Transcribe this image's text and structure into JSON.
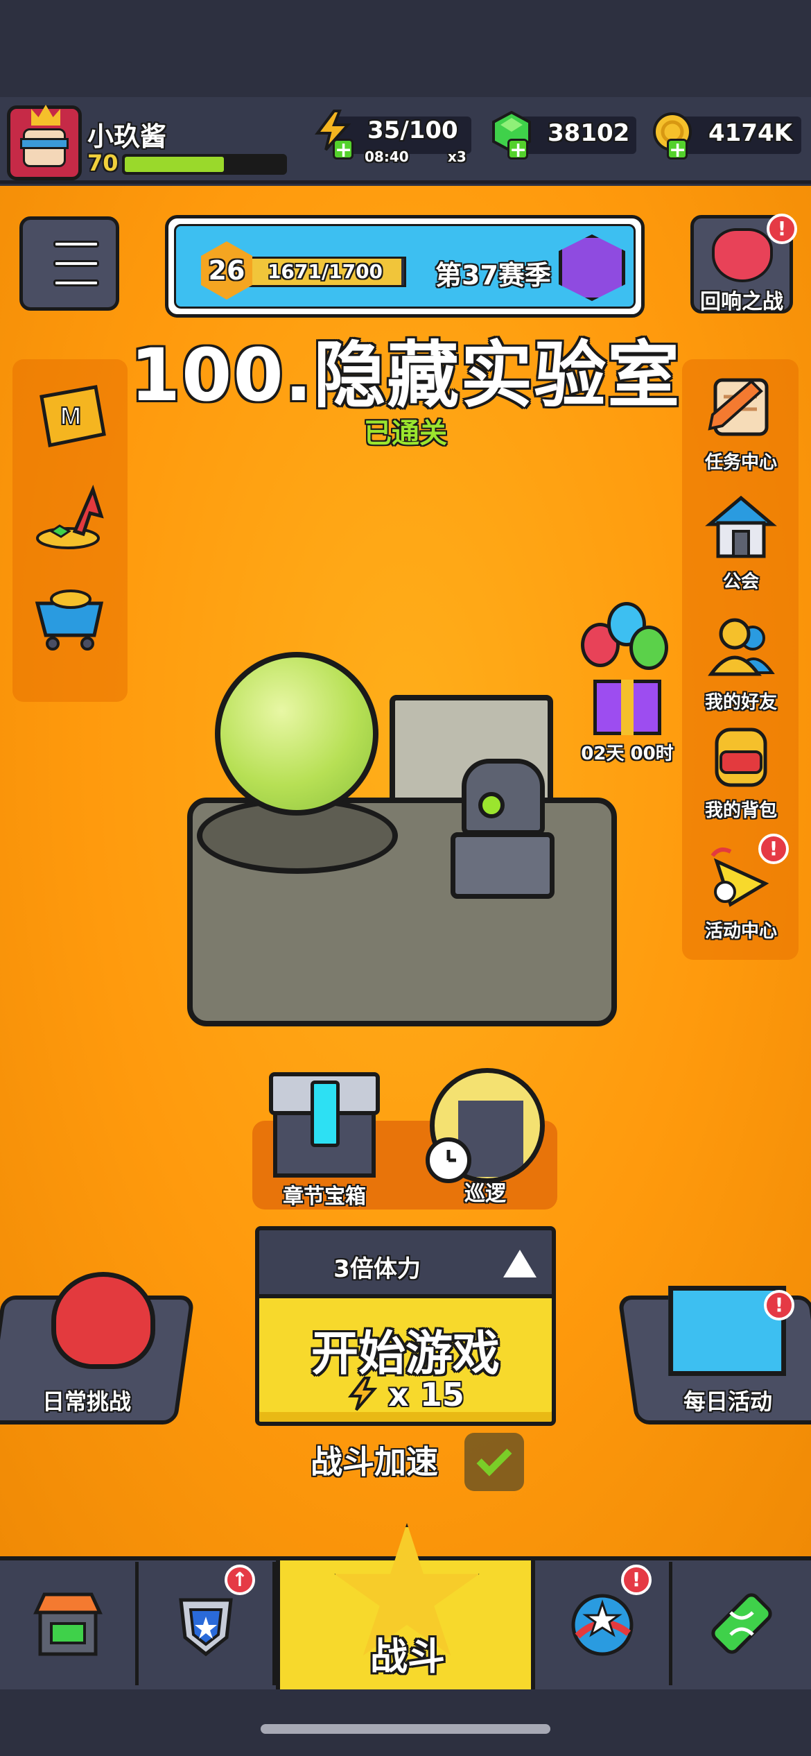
{
  "player": {
    "name": "小玖酱",
    "level": "70",
    "xp_fraction": 0.62
  },
  "resources": {
    "energy": {
      "value": "35/100",
      "timer": "08:40",
      "multiplier": "x3"
    },
    "gems": {
      "value": "38102"
    },
    "coins": {
      "value": "4174K"
    }
  },
  "season": {
    "level": "26",
    "progress": "1671/1700",
    "progress_fraction": 0.983,
    "label": "第37赛季"
  },
  "echo_battle": {
    "label": "回响之战",
    "alert": "!"
  },
  "level": {
    "title": "100.隐藏实验室",
    "status": "已通关"
  },
  "right_menu": [
    {
      "label": "任务中心"
    },
    {
      "label": "公会"
    },
    {
      "label": "我的好友"
    },
    {
      "label": "我的背包"
    },
    {
      "label": "活动中心",
      "alert": "!"
    }
  ],
  "gift": {
    "timer": "02天 00时"
  },
  "chapter_chest": {
    "label": "章节宝箱"
  },
  "patrol": {
    "label": "巡逻"
  },
  "start_panel": {
    "stamina_label": "3倍体力",
    "start_label": "开始游戏",
    "cost": "x 15"
  },
  "battle_speed": {
    "label": "战斗加速"
  },
  "daily_challenge": {
    "label": "日常挑战"
  },
  "daily_event": {
    "label": "每日活动",
    "alert": "!"
  },
  "nav": {
    "battle_label": "战斗",
    "alert": "!"
  },
  "colors": {
    "background_orange": "#ff9a0d",
    "accent_yellow": "#f7d92c",
    "alert_red": "#e53a45",
    "panel_dark": "#3d4155",
    "success_green": "#9be52e"
  }
}
